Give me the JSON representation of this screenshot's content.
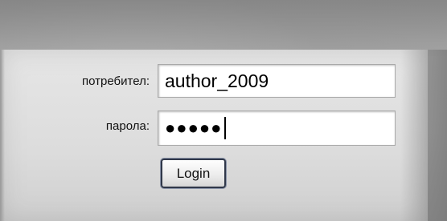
{
  "login_form": {
    "username_label": "потребител:",
    "username_value": "author_2009",
    "password_label": "парола:",
    "password_mask": "●●●●●",
    "login_button_label": "Login"
  }
}
